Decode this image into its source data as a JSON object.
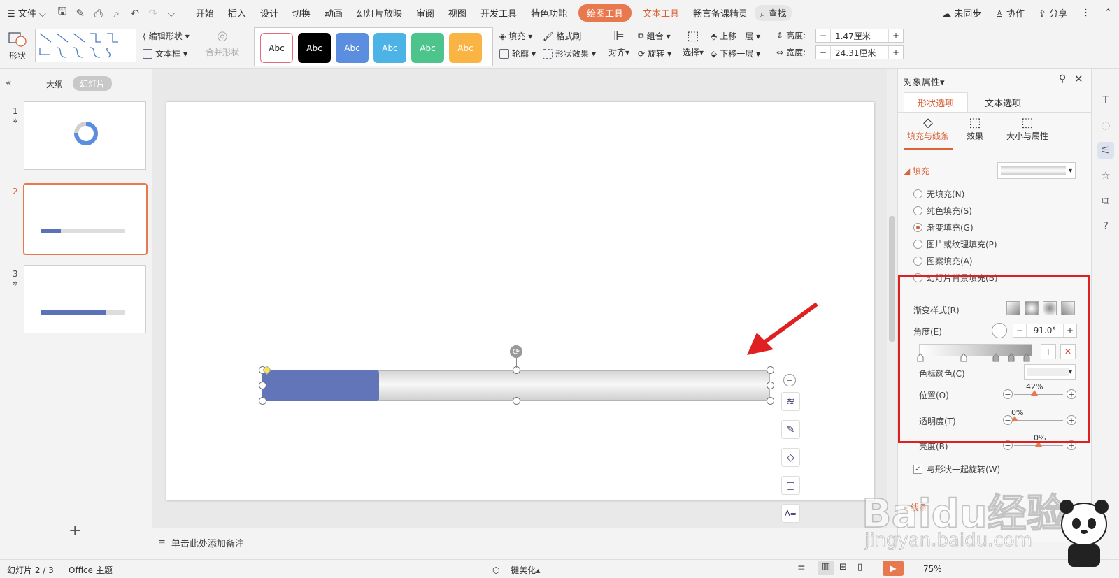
{
  "menu": {
    "main": "文件",
    "tabs": [
      "开始",
      "插入",
      "设计",
      "切换",
      "动画",
      "幻灯片放映",
      "审阅",
      "视图",
      "开发工具",
      "特色功能"
    ],
    "drawing_tools": "绘图工具",
    "text_tools": "文本工具",
    "extra": "畅言备课精灵",
    "search": "查找",
    "unsync": "未同步",
    "collab": "协作",
    "share": "分享"
  },
  "ribbon": {
    "shape": "形状",
    "edit_shape": "编辑形状",
    "textbox": "文本框",
    "merge_shape": "合并形状",
    "style_label": "Abc",
    "fill": "填充",
    "format_brush": "格式刷",
    "outline": "轮廓",
    "shape_effect": "形状效果",
    "align": "对齐",
    "group": "组合",
    "rotate": "旋转",
    "select": "选择",
    "bring_forward": "上移一层",
    "send_backward": "下移一层",
    "height_label": "高度:",
    "height_value": "1.47厘米",
    "width_label": "宽度:",
    "width_value": "24.31厘米",
    "minus": "−",
    "plus": "+",
    "style_colors": [
      "#ffffff",
      "#000000",
      "#5b8ede",
      "#4db3e6",
      "#4cc48c",
      "#f9b443"
    ]
  },
  "leftpane": {
    "outline_tab": "大纲",
    "slides_tab": "幻灯片",
    "slide_numbers": [
      "1",
      "2",
      "3"
    ],
    "add": "+"
  },
  "slide": {
    "bar_progress": 0.23
  },
  "notes": {
    "placeholder": "单击此处添加备注"
  },
  "panel": {
    "title": "对象属性",
    "tab_shape": "形状选项",
    "tab_text": "文本选项",
    "sub_fill_line": "填充与线条",
    "sub_effect": "效果",
    "sub_size": "大小与属性",
    "fill_header": "填充",
    "options": [
      "无填充(N)",
      "纯色填充(S)",
      "渐变填充(G)",
      "图片或纹理填充(P)",
      "图案填充(A)",
      "幻灯片背景填充(B)"
    ],
    "selected_option": 2,
    "gradient_style": "渐变样式(R)",
    "angle_label": "角度(E)",
    "angle_value": "91.0°",
    "stop_color": "色标颜色(C)",
    "position_label": "位置(O)",
    "position_value": "42%",
    "position_level": 0.42,
    "transparency_label": "透明度(T)",
    "transparency_value": "0%",
    "brightness_label": "亮度(B)",
    "brightness_value": "0%",
    "rotate_with_shape": "与形状一起旋转(W)",
    "line_header": "线条"
  },
  "status": {
    "slide_info": "幻灯片 2 / 3",
    "theme": "Office 主题",
    "beautify": "一键美化",
    "zoom": "75%"
  },
  "watermark": {
    "text": "Baidu经验",
    "url": "jingyan.baidu.com"
  }
}
